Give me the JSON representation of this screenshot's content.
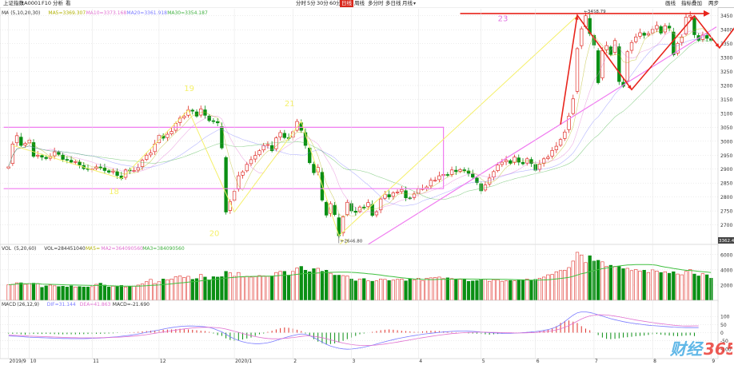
{
  "toolbar": {
    "left_label": "上证指数",
    "code": "1A0001",
    "buttons": [
      "F10",
      "分析",
      "看"
    ],
    "periods": [
      "分时",
      "5分",
      "30分",
      "60分",
      "日线",
      "周线",
      "多分时",
      "多日线",
      "月线"
    ],
    "active_period": "日线",
    "right_buttons": [
      "画线",
      "指标叠加",
      "两步"
    ]
  },
  "colors": {
    "up": "#e0302a",
    "down": "#0a8f14",
    "ma5": "#b0b000",
    "ma10": "#e070d0",
    "ma20": "#7a7aff",
    "ma30": "#40b040",
    "trend_red": "#e8241c",
    "trend_pink": "#f07cf0",
    "trend_yellow": "#f5f06a",
    "grid": "#d8d8d8"
  },
  "chart_data": {
    "type": "candlestick",
    "main_panel": {
      "legend": [
        "MA",
        "(5,10,20,30)",
        "MA5=3369.307",
        "MA10=3373.168",
        "MA20=3361.918",
        "MA30=3354.187"
      ],
      "y_ticks": [
        2700,
        2750,
        2800,
        2850,
        2900,
        2950,
        3000,
        3050,
        3100,
        3150,
        3200,
        3250,
        3300,
        3350,
        3400,
        3450
      ],
      "ylim": [
        2630,
        3475
      ],
      "current_price": "3362.42",
      "high_label": "3458.79",
      "low_label": "2646.80",
      "wave_labels": [
        "19",
        "20",
        "21",
        "22",
        "23",
        "18"
      ],
      "closes": [
        2908,
        2990,
        3020,
        2985,
        2992,
        3004,
        2946,
        2950,
        2943,
        2938,
        2945,
        2962,
        2953,
        2935,
        2933,
        2925,
        2927,
        2915,
        2902,
        2900,
        2901,
        2908,
        2906,
        2895,
        2889,
        2893,
        2877,
        2866,
        2897,
        2894,
        2895,
        2905,
        2932,
        2950,
        2958,
        2990,
        3021,
        3011,
        3025,
        3035,
        3064,
        3083,
        3090,
        3112,
        3108,
        3090,
        3116,
        3093,
        3074,
        3071,
        3066,
        2976,
        2746,
        2783,
        2820,
        2876,
        2890,
        2917,
        2934,
        2949,
        2966,
        2985,
        2988,
        2966,
        3012,
        3031,
        3013,
        3011,
        3034,
        3071,
        3039,
        2985,
        2923,
        2887,
        2906,
        2789,
        2735,
        2776,
        2737,
        2661,
        2729,
        2781,
        2750,
        2745,
        2764,
        2763,
        2780,
        2734,
        2747,
        2793,
        2810,
        2800,
        2815,
        2818,
        2827,
        2797,
        2796,
        2811,
        2829,
        2830,
        2836,
        2860,
        2860,
        2876,
        2881,
        2878,
        2897,
        2891,
        2898,
        2895,
        2885,
        2871,
        2852,
        2822,
        2843,
        2868,
        2891,
        2915,
        2925,
        2932,
        2921,
        2943,
        2925,
        2919,
        2937,
        2920,
        2896,
        2918,
        2937,
        2943,
        2967,
        2982,
        3006,
        3033,
        3090,
        3152,
        3332,
        3403,
        3450,
        3386,
        3345,
        3210,
        3325,
        3343,
        3311,
        3361,
        3214,
        3197,
        3321,
        3354,
        3374,
        3389,
        3380,
        3386,
        3401,
        3415,
        3388,
        3414,
        3406,
        3310,
        3351,
        3374,
        3445,
        3451,
        3382,
        3362,
        3381,
        3369,
        3362
      ],
      "x_ticks": [
        "2019/9",
        "10",
        "11",
        "12",
        "2020/1",
        "2",
        "3",
        "4",
        "5",
        "6",
        "7",
        "8",
        "9"
      ],
      "trendline_labels": [
        "3458.79",
        "2646.80"
      ]
    },
    "volume_panel": {
      "legend": [
        "VOL",
        "(5,20,60)",
        "VOL=284451040",
        "MA5=",
        "MA2=364090560",
        "MA3=384090560"
      ],
      "y_ticks": [
        2000,
        4000,
        6000
      ],
      "ylim": [
        0,
        6500
      ],
      "values": [
        2050,
        2100,
        2300,
        2300,
        2100,
        2200,
        2250,
        2200,
        1700,
        1900,
        2000,
        1900,
        1800,
        1850,
        1750,
        1900,
        1750,
        1800,
        1750,
        1750,
        1800,
        2100,
        2250,
        2000,
        1750,
        1850,
        1800,
        1950,
        1750,
        1850,
        1850,
        2000,
        2150,
        2450,
        2750,
        2200,
        2450,
        2800,
        2700,
        2800,
        3100,
        3200,
        3000,
        3150,
        2750,
        2850,
        3400,
        3050,
        2700,
        3100,
        3050,
        3100,
        3800,
        3600,
        3150,
        3650,
        3050,
        3150,
        3050,
        3100,
        3250,
        3200,
        3150,
        3200,
        3650,
        3800,
        3800,
        3300,
        3800,
        4250,
        4450,
        3950,
        3750,
        4150,
        4200,
        3800,
        3950,
        3550,
        3300,
        3300,
        3250,
        3200,
        2800,
        2550,
        2800,
        2850,
        2550,
        2500,
        2550,
        2800,
        2750,
        2600,
        2650,
        2750,
        2800,
        2550,
        2850,
        2700,
        2900,
        2600,
        2900,
        2950,
        3000,
        3050,
        2850,
        2950,
        2850,
        2800,
        2750,
        2750,
        2500,
        2550,
        2600,
        2750,
        2750,
        2500,
        2700,
        2700,
        2500,
        2550,
        2600,
        2550,
        2700,
        2700,
        2800,
        2600,
        2750,
        2900,
        3050,
        3350,
        3400,
        3750,
        3900,
        3950,
        4300,
        5150,
        6300,
        5950,
        4950,
        5850,
        5150,
        5250,
        5050,
        4450,
        4600,
        4450,
        4450,
        4150,
        4200,
        3900,
        4050,
        3850,
        3950,
        3650,
        4000,
        3850,
        3650,
        3750,
        3550,
        3750,
        3450,
        3350,
        3800,
        4050,
        3450,
        3200,
        3500,
        3350,
        2900
      ]
    },
    "macd_panel": {
      "legend": [
        "MACD",
        "(26,12,9)",
        "DIF=31.144",
        "DEA=41.863",
        "MACD=-21.690"
      ],
      "y_ticks": [
        100,
        50,
        0,
        -50,
        -100
      ],
      "ylim": [
        -150,
        160
      ],
      "bars": [
        -8,
        -7,
        -6,
        -10,
        -12,
        -10,
        -8,
        -8,
        -8,
        -7,
        -8,
        -9,
        -10,
        -10,
        -9,
        -10,
        -10,
        -9,
        -9,
        -8,
        -8,
        -7,
        -7,
        -6,
        -5,
        -4,
        -2,
        0,
        1,
        2,
        3,
        5,
        8,
        10,
        12,
        13,
        15,
        18,
        19,
        20,
        22,
        24,
        22,
        20,
        18,
        15,
        12,
        10,
        5,
        -5,
        -15,
        -20,
        -35,
        -45,
        -50,
        -48,
        -42,
        -36,
        -30,
        -20,
        -10,
        -5,
        5,
        12,
        20,
        28,
        32,
        30,
        25,
        18,
        10,
        -5,
        -20,
        -40,
        -55,
        -65,
        -72,
        -70,
        -66,
        -60,
        -50,
        -40,
        -30,
        -20,
        -10,
        -5,
        0,
        5,
        10,
        15,
        18,
        20,
        18,
        15,
        12,
        10,
        8,
        5,
        6,
        8,
        10,
        12,
        11,
        10,
        8,
        6,
        4,
        2,
        0,
        -2,
        -4,
        -5,
        -6,
        -8,
        -10,
        -12,
        -10,
        -8,
        -6,
        -4,
        -3,
        -2,
        0,
        2,
        4,
        6,
        8,
        10,
        14,
        20,
        28,
        40,
        60,
        72,
        75,
        68,
        60,
        40,
        25,
        15,
        0,
        -15,
        -30,
        -38,
        -40,
        -38,
        -35,
        -30,
        -28,
        -25,
        -22,
        -20,
        -18,
        -14,
        -10,
        -8,
        -12,
        -15,
        -18,
        -20,
        -22,
        -20,
        -18,
        -16,
        -21
      ],
      "dif": [
        -20,
        -21,
        -22,
        -24,
        -26,
        -28,
        -29,
        -30,
        -31,
        -32,
        -33,
        -34,
        -35,
        -36,
        -36,
        -37,
        -37,
        -37,
        -37,
        -36,
        -35,
        -34,
        -33,
        -31,
        -29,
        -27,
        -25,
        -22,
        -19,
        -16,
        -12,
        -8,
        -3,
        2,
        7,
        12,
        17,
        22,
        27,
        31,
        35,
        38,
        40,
        41,
        41,
        40,
        38,
        36,
        32,
        25,
        15,
        5,
        -10,
        -25,
        -38,
        -48,
        -56,
        -62,
        -66,
        -68,
        -68,
        -66,
        -62,
        -56,
        -48,
        -40,
        -32,
        -24,
        -18,
        -12,
        -8,
        -10,
        -18,
        -30,
        -44,
        -58,
        -72,
        -82,
        -90,
        -96,
        -100,
        -102,
        -101,
        -98,
        -94,
        -89,
        -83,
        -77,
        -70,
        -63,
        -56,
        -49,
        -43,
        -37,
        -32,
        -27,
        -22,
        -18,
        -14,
        -10,
        -7,
        -4,
        -1,
        2,
        4,
        6,
        8,
        9,
        10,
        10,
        9,
        8,
        6,
        4,
        2,
        0,
        -2,
        -3,
        -4,
        -4,
        -4,
        -3,
        -2,
        0,
        2,
        4,
        7,
        10,
        14,
        19,
        26,
        35,
        50,
        68,
        88,
        108,
        122,
        128,
        128,
        124,
        118,
        110,
        102,
        94,
        86,
        80,
        74,
        68,
        63,
        59,
        55,
        52,
        49,
        46,
        44,
        42,
        40,
        38,
        36,
        34,
        33,
        32,
        31,
        31,
        31,
        31
      ],
      "dea": [
        -15,
        -16,
        -17,
        -18,
        -19,
        -21,
        -22,
        -23,
        -24,
        -25,
        -26,
        -27,
        -28,
        -29,
        -30,
        -31,
        -31,
        -32,
        -32,
        -32,
        -32,
        -32,
        -31,
        -31,
        -30,
        -29,
        -28,
        -27,
        -25,
        -23,
        -21,
        -18,
        -15,
        -12,
        -8,
        -4,
        0,
        4,
        8,
        12,
        16,
        20,
        23,
        26,
        29,
        31,
        32,
        33,
        33,
        32,
        30,
        27,
        22,
        16,
        9,
        2,
        -5,
        -12,
        -18,
        -24,
        -29,
        -33,
        -36,
        -38,
        -38,
        -37,
        -35,
        -33,
        -30,
        -27,
        -23,
        -20,
        -20,
        -22,
        -26,
        -31,
        -37,
        -44,
        -51,
        -58,
        -64,
        -69,
        -73,
        -76,
        -78,
        -79,
        -79,
        -78,
        -76,
        -73,
        -70,
        -66,
        -62,
        -58,
        -53,
        -49,
        -44,
        -40,
        -35,
        -31,
        -27,
        -23,
        -19,
        -15,
        -12,
        -9,
        -6,
        -4,
        -2,
        0,
        1,
        2,
        3,
        3,
        3,
        2,
        2,
        1,
        0,
        -1,
        -1,
        -2,
        -2,
        -2,
        -1,
        0,
        1,
        3,
        5,
        8,
        12,
        17,
        24,
        33,
        44,
        57,
        71,
        84,
        95,
        103,
        108,
        110,
        110,
        109,
        106,
        102,
        98,
        93,
        88,
        83,
        78,
        74,
        70,
        66,
        62,
        58,
        55,
        52,
        49,
        46,
        44,
        42,
        41,
        41,
        42,
        42
      ]
    }
  }
}
